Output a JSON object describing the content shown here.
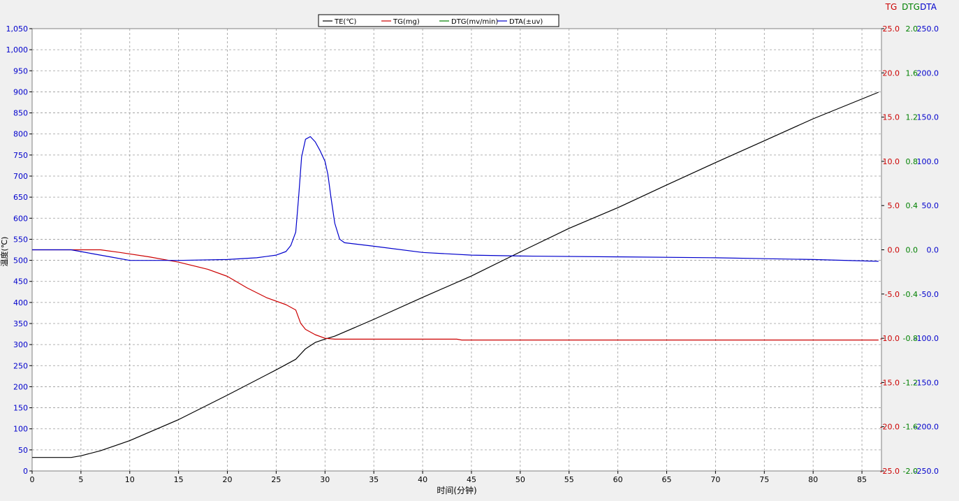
{
  "chart_data": {
    "type": "line",
    "title": "",
    "legend": {
      "placement": "top-center",
      "entries": [
        {
          "label": "TE(℃)",
          "color": "#000000"
        },
        {
          "label": "TG(mg)",
          "color": "#cc0000"
        },
        {
          "label": "DTG(mv/min)",
          "color": "#008000"
        },
        {
          "label": "DTA(±uv)",
          "color": "#0000cc"
        }
      ]
    },
    "grid": true,
    "x_axis": {
      "label": "时间(分钟)",
      "range": [
        0,
        87
      ],
      "ticks": [
        "0",
        "5",
        "10",
        "15",
        "20",
        "25",
        "30",
        "35",
        "40",
        "45",
        "50",
        "55",
        "60",
        "65",
        "70",
        "75",
        "80",
        "85"
      ]
    },
    "y_left": {
      "label": "温度(℃)",
      "range": [
        0,
        1050
      ],
      "color": "#0000cc",
      "ticks": [
        "0",
        "50",
        "100",
        "150",
        "200",
        "250",
        "300",
        "350",
        "400",
        "450",
        "500",
        "550",
        "600",
        "650",
        "700",
        "750",
        "800",
        "850",
        "900",
        "950",
        "1,000",
        "1,050"
      ]
    },
    "right_axes": [
      {
        "name": "TG",
        "color": "#cc0000",
        "range": [
          -25,
          25
        ],
        "ticks": [
          "-25.0",
          "-20.0",
          "-15.0",
          "-10.0",
          "-5.0",
          "0.0",
          "5.0",
          "10.0",
          "15.0",
          "20.0",
          "25.0"
        ]
      },
      {
        "name": "DTG",
        "color": "#008000",
        "range": [
          -2.0,
          2.0
        ],
        "ticks": [
          "-2.0",
          "-1.6",
          "-1.2",
          "-0.8",
          "-0.4",
          "0.0",
          "0.4",
          "0.8",
          "1.2",
          "1.6",
          "2.0"
        ]
      },
      {
        "name": "DTA",
        "color": "#0000cc",
        "range": [
          -250,
          250
        ],
        "ticks": [
          "-250.0",
          "-200.0",
          "-150.0",
          "-100.0",
          "-50.0",
          "0.0",
          "50.0",
          "100.0",
          "150.0",
          "200.0",
          "250.0"
        ]
      }
    ],
    "series": [
      {
        "name": "TE(℃)",
        "axis": "y_left",
        "color": "#000000",
        "x": [
          0,
          4,
          5,
          7,
          10,
          15,
          20,
          25,
          27,
          28,
          29,
          30,
          31,
          35,
          40,
          45,
          50,
          55,
          60,
          65,
          70,
          75,
          80,
          86.7
        ],
        "y": [
          32,
          32,
          36,
          48,
          72,
          122,
          180,
          240,
          265,
          290,
          305,
          313,
          320,
          360,
          412,
          463,
          520,
          576,
          625,
          679,
          732,
          784,
          836,
          899
        ]
      },
      {
        "name": "TG(mg)",
        "axis": "TG",
        "color": "#cc0000",
        "x": [
          0,
          4,
          7,
          9,
          12,
          15,
          18,
          20,
          22,
          24,
          26,
          27,
          27.5,
          28,
          29,
          30,
          31,
          35,
          43.5,
          44,
          60,
          86.7
        ],
        "y": [
          0,
          0,
          0,
          -0.3,
          -0.8,
          -1.4,
          -2.2,
          -3.0,
          -4.3,
          -5.4,
          -6.2,
          -6.8,
          -8.3,
          -9.0,
          -9.6,
          -10.0,
          -10.1,
          -10.1,
          -10.1,
          -10.2,
          -10.2,
          -10.2
        ]
      },
      {
        "name": "DTG(mv/min)",
        "axis": "DTG",
        "color": "#008000",
        "x": [],
        "y": []
      },
      {
        "name": "DTA(±uv)",
        "axis": "DTA",
        "color": "#0000cc",
        "x": [
          0,
          4,
          6,
          8,
          10,
          12,
          15,
          20,
          23,
          25,
          26,
          26.5,
          27,
          27.3,
          27.6,
          28,
          28.5,
          29,
          29.5,
          30,
          30.3,
          30.6,
          31,
          31.5,
          32,
          35,
          40,
          45,
          50,
          60,
          70,
          75,
          80,
          86.7
        ],
        "y": [
          0,
          0,
          -4,
          -8,
          -12,
          -12,
          -12,
          -11,
          -9,
          -6,
          -2,
          5,
          20,
          60,
          105,
          125,
          128,
          122,
          112,
          100,
          85,
          60,
          30,
          12,
          8,
          4,
          -3,
          -6,
          -7,
          -8,
          -9,
          -10,
          -11,
          -13
        ]
      }
    ]
  }
}
